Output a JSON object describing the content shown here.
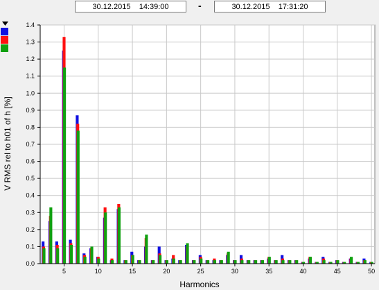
{
  "header": {
    "start_datetime": "30.12.2015    14:39:00",
    "separator": "-",
    "end_datetime": "30.12.2015    17:31:20"
  },
  "legend": {
    "collapse_icon": "triangle-down-icon"
  },
  "chart_data": {
    "type": "bar",
    "xlabel": "Harmonics",
    "ylabel": "V RMS rel to h01 of h [%]",
    "xlim": [
      1.5,
      50.5
    ],
    "ylim": [
      0,
      1.4
    ],
    "yticks": [
      0.0,
      0.1,
      0.2,
      0.3,
      0.4,
      0.5,
      0.6,
      0.7,
      0.8,
      0.9,
      1.0,
      1.1,
      1.2,
      1.3,
      1.4
    ],
    "xticks": [
      5,
      10,
      15,
      20,
      25,
      30,
      35,
      40,
      45,
      50
    ],
    "grid": true,
    "legend_placement": "top-left",
    "categories": [
      2,
      3,
      4,
      5,
      6,
      7,
      8,
      9,
      10,
      11,
      12,
      13,
      14,
      15,
      16,
      17,
      18,
      19,
      20,
      21,
      22,
      23,
      24,
      25,
      26,
      27,
      28,
      29,
      30,
      31,
      32,
      33,
      34,
      35,
      36,
      37,
      38,
      39,
      40,
      41,
      42,
      43,
      44,
      45,
      46,
      47,
      48,
      49,
      50
    ],
    "series": [
      {
        "color": "#1010e0",
        "values": [
          0.13,
          0.25,
          0.13,
          1.25,
          0.14,
          0.87,
          0.06,
          0.09,
          0.04,
          0.27,
          0.02,
          0.32,
          0.02,
          0.07,
          0.02,
          0.1,
          0.02,
          0.1,
          0.02,
          0.03,
          0.02,
          0.11,
          0.02,
          0.05,
          0.02,
          0.02,
          0.02,
          0.05,
          0.02,
          0.05,
          0.02,
          0.02,
          0.02,
          0.03,
          0.02,
          0.05,
          0.02,
          0.02,
          0.01,
          0.03,
          0.01,
          0.04,
          0.01,
          0.02,
          0.01,
          0.03,
          0.01,
          0.03,
          0.01
        ]
      },
      {
        "color": "#ff1010",
        "values": [
          0.1,
          0.28,
          0.11,
          1.33,
          0.12,
          0.82,
          0.05,
          0.09,
          0.04,
          0.33,
          0.03,
          0.35,
          0.02,
          0.05,
          0.02,
          0.15,
          0.02,
          0.06,
          0.02,
          0.05,
          0.02,
          0.1,
          0.02,
          0.04,
          0.02,
          0.03,
          0.02,
          0.06,
          0.02,
          0.03,
          0.02,
          0.02,
          0.02,
          0.04,
          0.02,
          0.03,
          0.02,
          0.02,
          0.01,
          0.04,
          0.01,
          0.03,
          0.01,
          0.02,
          0.01,
          0.03,
          0.01,
          0.02,
          0.01
        ]
      },
      {
        "color": "#10a010",
        "values": [
          0.09,
          0.33,
          0.09,
          1.15,
          0.11,
          0.78,
          0.04,
          0.1,
          0.03,
          0.3,
          0.02,
          0.33,
          0.02,
          0.05,
          0.02,
          0.17,
          0.02,
          0.05,
          0.02,
          0.03,
          0.02,
          0.12,
          0.02,
          0.03,
          0.02,
          0.02,
          0.02,
          0.07,
          0.02,
          0.02,
          0.02,
          0.02,
          0.02,
          0.04,
          0.02,
          0.02,
          0.02,
          0.02,
          0.01,
          0.04,
          0.01,
          0.02,
          0.01,
          0.02,
          0.01,
          0.04,
          0.01,
          0.02,
          0.01
        ]
      }
    ]
  }
}
